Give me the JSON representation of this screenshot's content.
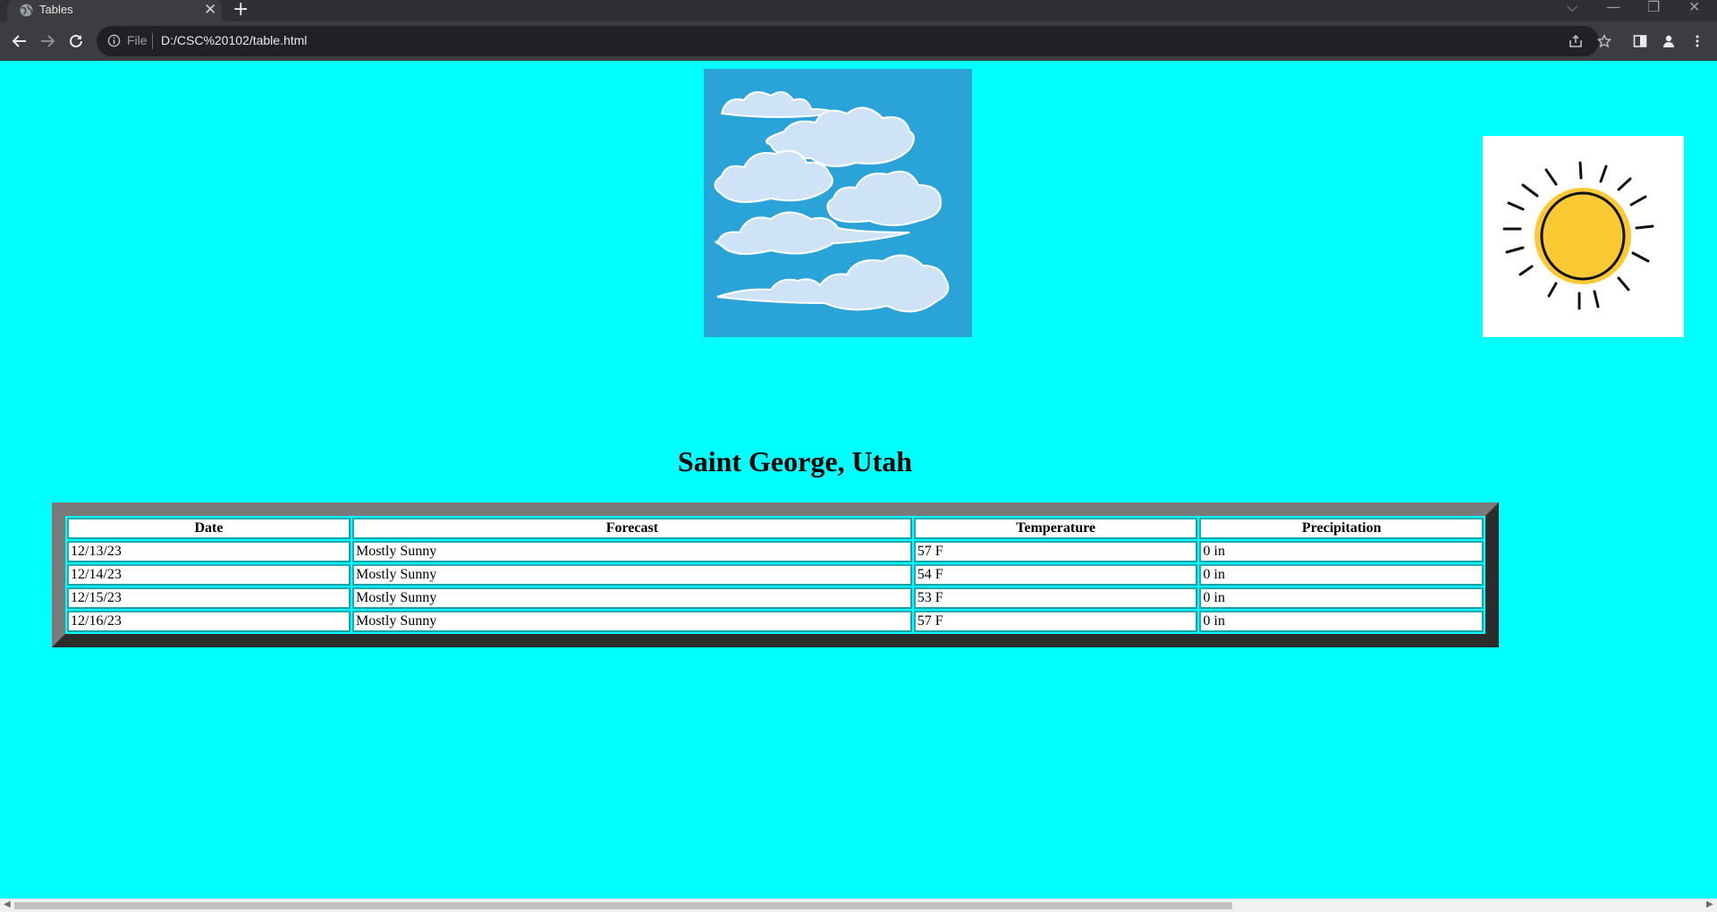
{
  "browser": {
    "tab_title": "Tables",
    "tab_close_glyph": "✕",
    "new_tab_glyph": "+",
    "url_scheme": "File",
    "url": "D:/CSC%20102/table.html",
    "icons": [
      "globe-icon",
      "back-icon",
      "forward-icon",
      "reload-icon",
      "info-icon",
      "share-icon",
      "star-icon",
      "side-panel-icon",
      "profile-icon",
      "menu-icon"
    ],
    "window_controls": {
      "dropdown": "⌵",
      "minimize": "—",
      "restore": "❐",
      "close": "✕"
    }
  },
  "page": {
    "background": "#00ffff",
    "title": "Saint George, Utah",
    "images": {
      "clouds": "clouds-picture",
      "sun": "sun-picture"
    }
  },
  "table": {
    "headers": [
      "Date",
      "Forecast",
      "Temperature",
      "Precipitation"
    ],
    "rows": [
      [
        "12/13/23",
        "Mostly Sunny",
        "57 F",
        "0 in"
      ],
      [
        "12/14/23",
        "Mostly Sunny",
        "54 F",
        "0 in"
      ],
      [
        "12/15/23",
        "Mostly Sunny",
        "53 F",
        "0 in"
      ],
      [
        "12/16/23",
        "Mostly Sunny",
        "57 F",
        "0 in"
      ]
    ]
  },
  "scrollbar": {
    "left_arrow": "◀",
    "right_arrow": "▶"
  }
}
